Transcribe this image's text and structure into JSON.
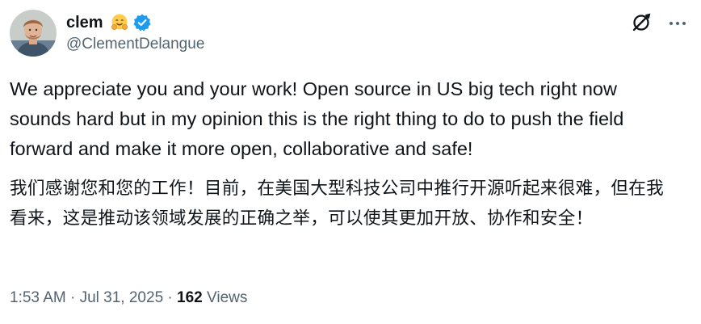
{
  "author": {
    "display_name": "clem",
    "emoji": "hugging-face-emoji",
    "verified": true,
    "handle": "@ClementDelangue"
  },
  "actions": {
    "grok_icon": "grok-icon",
    "more_icon": "more-icon"
  },
  "post": {
    "text_en": "We appreciate you and your work! Open source in US big tech right now sounds hard but in my opinion this is the right thing to do to push the field forward and make it more open, collaborative and safe!",
    "text_zh": "我们感谢您和您的工作！目前，在美国大型科技公司中推行开源听起来很难，但在我看来，这是推动该领域发展的正确之举，可以使其更加开放、协作和安全！"
  },
  "meta": {
    "time": "1:53 AM",
    "sep1": " · ",
    "date": "Jul 31, 2025",
    "sep2": " · ",
    "views_count": "162",
    "views_label": " Views"
  },
  "colors": {
    "text": "#0f1419",
    "muted": "#536471",
    "verified": "#1d9bf0"
  }
}
